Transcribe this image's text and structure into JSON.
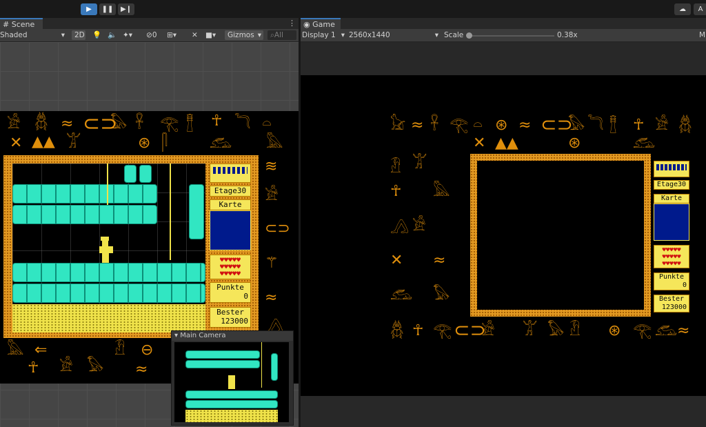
{
  "toolbar": {
    "play_icon": "play-icon",
    "pause_icon": "pause-icon",
    "step_icon": "step-icon",
    "account_label": "A"
  },
  "scene_view": {
    "tab_label": "Scene",
    "shading_mode": "Shaded",
    "mode_2d": "2D",
    "hidden_count": "0",
    "gizmos_label": "Gizmos",
    "search_placeholder": "All",
    "camera_preview_title": "Main Camera",
    "panel": {
      "etage": "Etage30",
      "karte": "Karte",
      "punkte": "Punkte",
      "punkte_value": "0",
      "bester": "Bester",
      "bester_value": "123000"
    }
  },
  "game_view": {
    "tab_label": "Game",
    "display": "Display 1",
    "resolution": "2560x1440",
    "scale_label": "Scale",
    "scale_value": "0.38x",
    "scale_fraction": 0.0,
    "panel": {
      "etage": "Etage30",
      "karte": "Karte",
      "punkte": "Punkte",
      "punkte_value": "0",
      "bester": "Bester",
      "bester_value": "123000"
    }
  },
  "colors": {
    "accent": "#3a79bb",
    "hieroglyph": "#e08f0c",
    "panel_yellow": "#f5e65a",
    "map_blue": "#001a8c",
    "stone_cyan": "#31e6c2",
    "heart_red": "#d01010"
  }
}
